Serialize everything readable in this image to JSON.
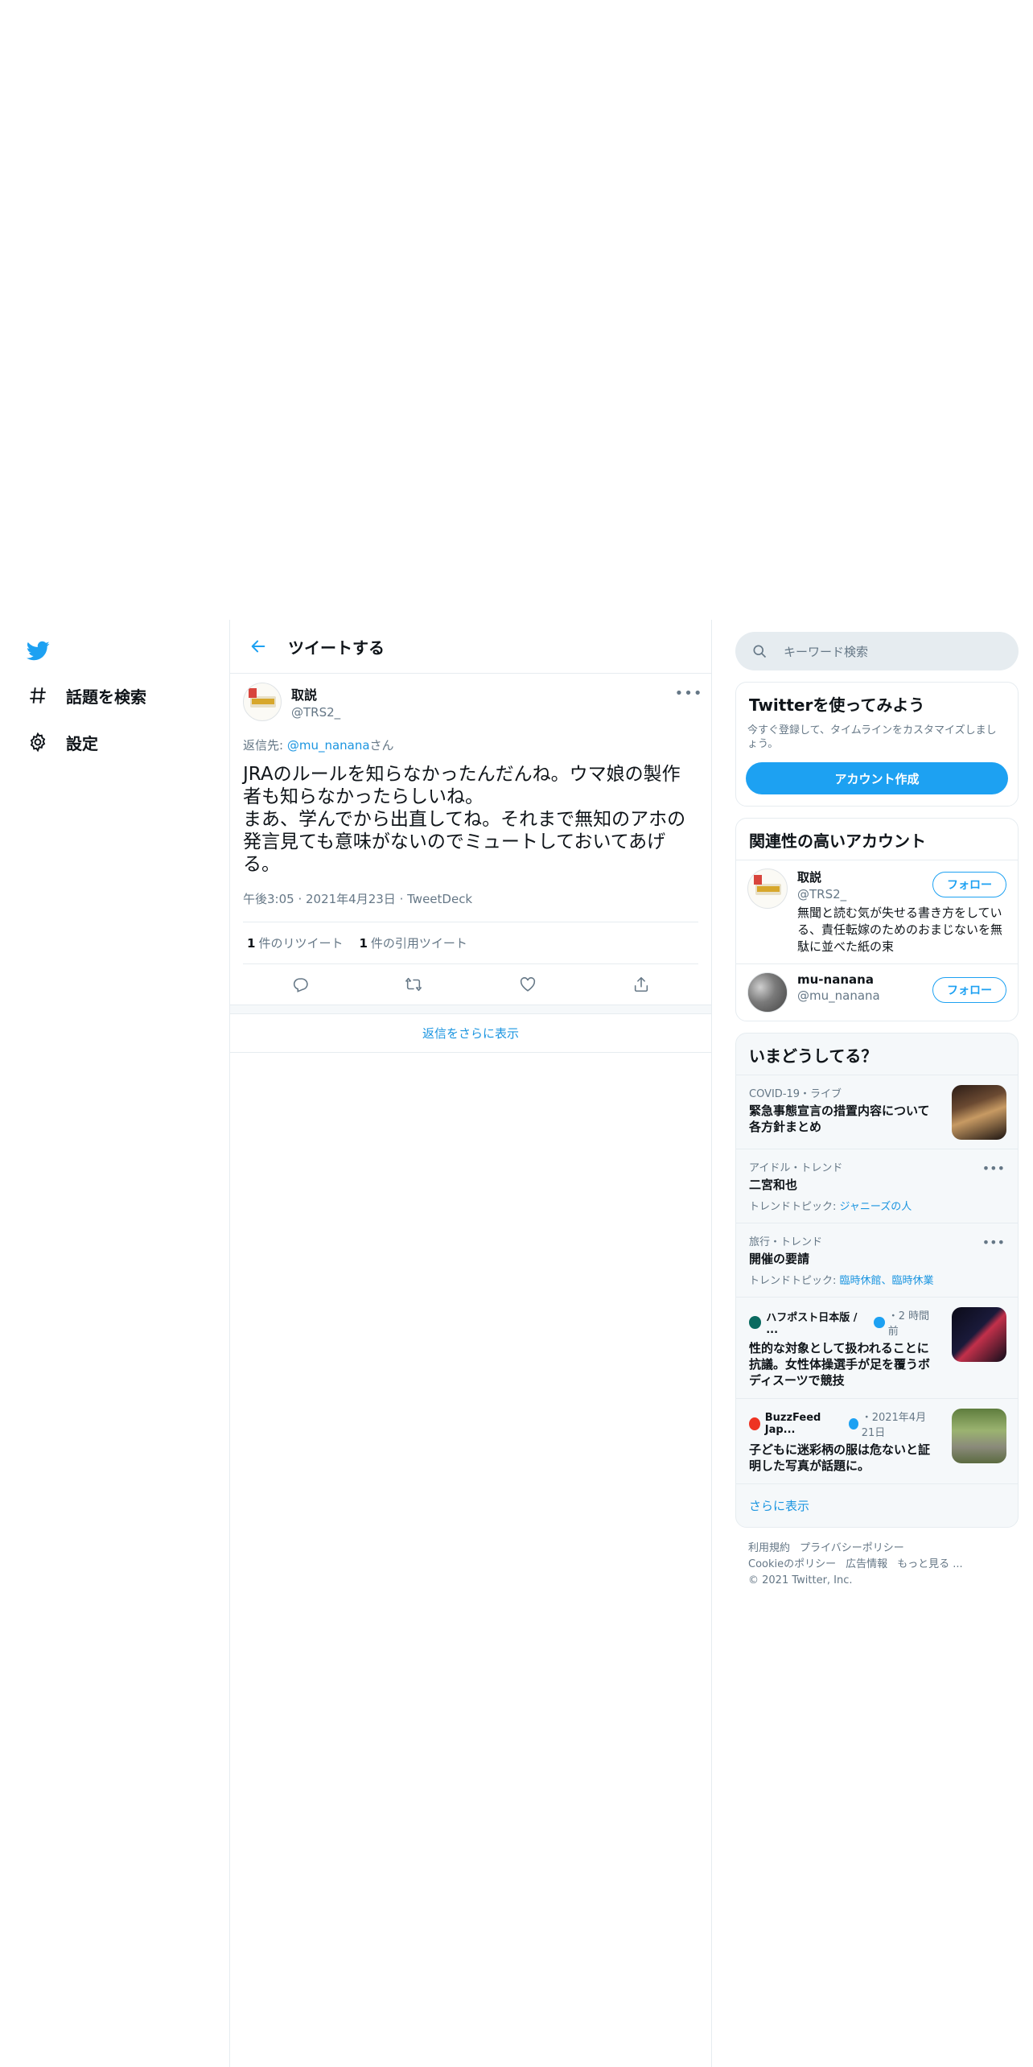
{
  "nav": {
    "items": [
      {
        "label": "話題を検索",
        "icon": "hashtag-icon"
      },
      {
        "label": "設定",
        "icon": "gear-icon"
      }
    ]
  },
  "header": {
    "title": "ツイートする"
  },
  "tweet": {
    "name": "取説",
    "handle": "@TRS2_",
    "reply_prefix": "返信先: ",
    "reply_to": "@mu_nanana",
    "reply_suffix": "さん",
    "text": "JRAのルールを知らなかったんだんね。ウマ娘の製作者も知らなかったらしいね。\nまあ、学んでから出直してね。それまで無知のアホの発言見ても意味がないのでミュートしておいてあげる。",
    "time": "午後3:05",
    "date": "2021年4月23日",
    "client": "TweetDeck",
    "retweets_count": "1",
    "retweets_label": "件のリツイート",
    "quotes_count": "1",
    "quotes_label": "件の引用ツイート"
  },
  "more_replies": "返信をさらに表示",
  "search": {
    "placeholder": "キーワード検索"
  },
  "signup": {
    "title": "Twitterを使ってみよう",
    "subtitle": "今すぐ登録して、タイムラインをカスタマイズしましょう。",
    "button": "アカウント作成"
  },
  "related": {
    "title": "関連性の高いアカウント",
    "follow_label": "フォロー",
    "accounts": [
      {
        "name": "取説",
        "handle": "@TRS2_",
        "bio": "無聞と読む気が失せる書き方をしている、責任転嫁のためのおまじないを無駄に並べた紙の束"
      },
      {
        "name": "mu-nanana",
        "handle": "@mu_nanana",
        "bio": ""
      }
    ]
  },
  "trends": {
    "title": "いまどうしてる？",
    "items": [
      {
        "context": "COVID-19・ライブ",
        "title": "緊急事態宣言の措置内容について各方針まとめ"
      },
      {
        "context": "アイドル・トレンド",
        "title": "二宮和也",
        "topic_prefix": "トレンドトピック: ",
        "topic": "ジャニーズの人"
      },
      {
        "context": "旅行・トレンド",
        "title": "開催の要請",
        "topic_prefix": "トレンドトピック: ",
        "topic": "臨時休館、臨時休業"
      },
      {
        "source": "ハフポスト日本版 / ...",
        "time": "・2 時間前",
        "title": "性的な対象として扱われることに抗議。女性体操選手が足を覆うボディスーツで競技"
      },
      {
        "source": "BuzzFeed Jap...",
        "time": "・2021年4月21日",
        "title": "子どもに迷彩柄の服は危ないと証明した写真が話題に。"
      }
    ],
    "show_more": "さらに表示"
  },
  "footer": {
    "links": [
      "利用規約",
      "プライバシーポリシー",
      "Cookieのポリシー",
      "広告情報",
      "もっと見る ..."
    ],
    "copyright": "© 2021 Twitter, Inc."
  },
  "colors": {
    "accent": "#1da1f2",
    "link": "#1b95e0",
    "muted": "#657786",
    "text": "#0f1419"
  }
}
